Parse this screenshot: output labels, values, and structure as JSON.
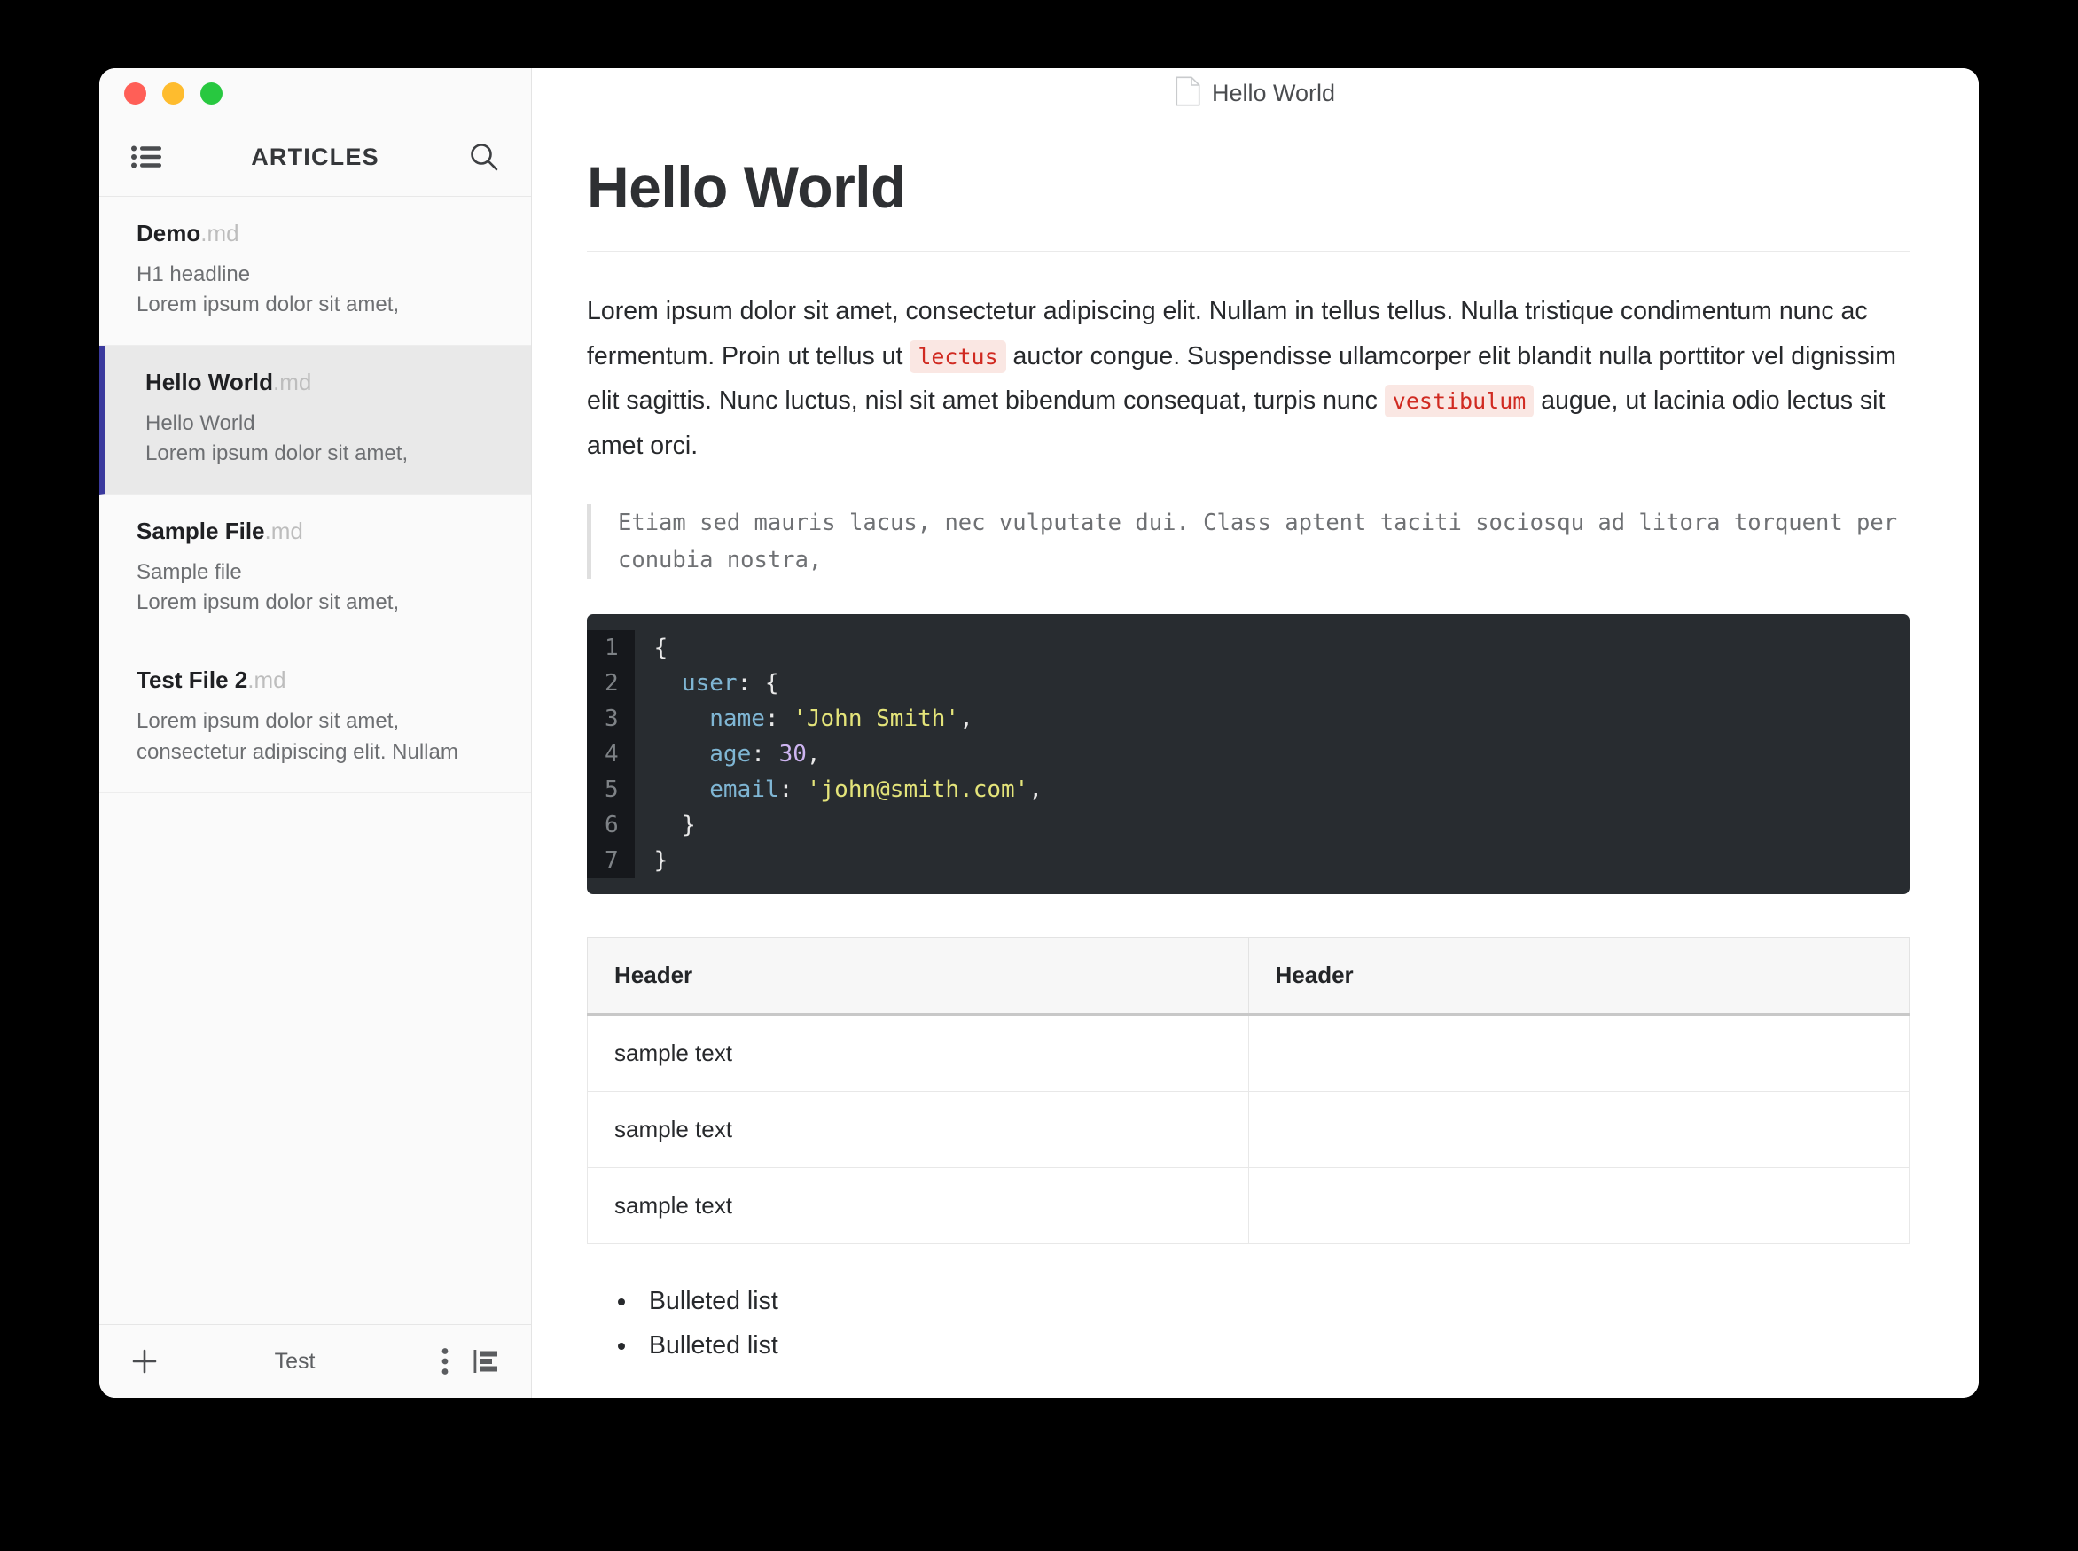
{
  "window": {
    "traffic_lights": [
      {
        "name": "close",
        "color": "#ff5f57"
      },
      {
        "name": "minimize",
        "color": "#febc2e"
      },
      {
        "name": "zoom",
        "color": "#28c840"
      }
    ]
  },
  "sidebar": {
    "title": "ARTICLES",
    "list_icon": "list-icon",
    "search_icon": "search-icon",
    "items": [
      {
        "name": "Demo",
        "ext": ".md",
        "preview_1": "H1 headline",
        "preview_2": "Lorem ipsum dolor sit amet,",
        "active": false
      },
      {
        "name": "Hello World",
        "ext": ".md",
        "preview_1": "Hello World",
        "preview_2": "Lorem ipsum dolor sit amet,",
        "active": true
      },
      {
        "name": "Sample File",
        "ext": ".md",
        "preview_1": "Sample file",
        "preview_2": "Lorem ipsum dolor sit amet,",
        "active": false
      },
      {
        "name": "Test File 2",
        "ext": ".md",
        "preview_1": "Lorem ipsum dolor sit amet,",
        "preview_2": "consectetur adipiscing elit. Nullam",
        "active": false
      }
    ],
    "footer": {
      "add_label": "+",
      "label": "Test",
      "more_icon": "more-vertical-icon",
      "layout_icon": "panel-layout-icon"
    },
    "accent_color": "#3b3a9e"
  },
  "content": {
    "titlebar": {
      "doc_icon": "document-icon",
      "title": "Hello World"
    },
    "heading": "Hello World",
    "paragraph": {
      "part_1": "Lorem ipsum dolor sit amet, consectetur adipiscing elit. Nullam in tellus tellus. Nulla tristique condimentum nunc ac fermentum. Proin ut tellus ut ",
      "code_1": "lectus",
      "part_2": " auctor congue. Suspendisse ullamcorper elit blandit nulla porttitor vel dignissim elit sagittis. Nunc luctus, nisl sit amet bibendum consequat, turpis nunc ",
      "code_2": "vestibulum",
      "part_3": " augue, ut lacinia odio lectus sit amet orci."
    },
    "blockquote": "Etiam sed mauris lacus, nec vulputate dui. Class aptent taciti sociosqu ad litora torquent per conubia nostra,",
    "code_block": {
      "language": "json",
      "line_numbers": [
        "1",
        "2",
        "3",
        "4",
        "5",
        "6",
        "7"
      ],
      "lines": [
        [
          {
            "t": "{",
            "c": "pun"
          }
        ],
        [
          {
            "t": "  ",
            "c": "pun"
          },
          {
            "t": "user",
            "c": "key"
          },
          {
            "t": ": {",
            "c": "pun"
          }
        ],
        [
          {
            "t": "    ",
            "c": "pun"
          },
          {
            "t": "name",
            "c": "key"
          },
          {
            "t": ": ",
            "c": "pun"
          },
          {
            "t": "'John Smith'",
            "c": "str"
          },
          {
            "t": ",",
            "c": "pun"
          }
        ],
        [
          {
            "t": "    ",
            "c": "pun"
          },
          {
            "t": "age",
            "c": "key"
          },
          {
            "t": ": ",
            "c": "pun"
          },
          {
            "t": "30",
            "c": "num"
          },
          {
            "t": ",",
            "c": "pun"
          }
        ],
        [
          {
            "t": "    ",
            "c": "pun"
          },
          {
            "t": "email",
            "c": "key"
          },
          {
            "t": ": ",
            "c": "pun"
          },
          {
            "t": "'john@smith.com'",
            "c": "str"
          },
          {
            "t": ",",
            "c": "pun"
          }
        ],
        [
          {
            "t": "  }",
            "c": "pun"
          }
        ],
        [
          {
            "t": "}",
            "c": "pun"
          }
        ]
      ],
      "colors": {
        "background": "#282c30",
        "gutter": "#16181c",
        "key": "#7fb6d4",
        "string": "#e4e47a",
        "number": "#cdb4f0",
        "punctuation": "#e9e9e9"
      }
    },
    "table": {
      "headers": [
        "Header",
        "Header"
      ],
      "rows": [
        [
          "sample text",
          ""
        ],
        [
          "sample text",
          ""
        ],
        [
          "sample text",
          ""
        ]
      ]
    },
    "bulleted_list": [
      "Bulleted list",
      "Bulleted list"
    ],
    "inline_code_colors": {
      "text": "#d02a21",
      "background": "#fae7e3"
    }
  }
}
